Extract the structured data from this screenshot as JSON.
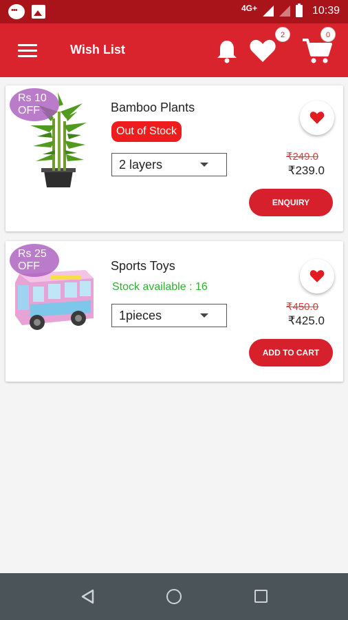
{
  "status_bar": {
    "network": "4G+",
    "time": "10:39"
  },
  "header": {
    "title": "Wish List",
    "wishlist_count": "2",
    "cart_count": "0"
  },
  "colors": {
    "primary": "#d9232d",
    "status_bar": "#a8141a",
    "stock_available": "#2fae33",
    "out_of_stock": "#ee1c1c",
    "badge": "#aa5abe"
  },
  "products": [
    {
      "name": "Bamboo Plants",
      "offer_line1": "Rs  10",
      "offer_line2": "OFF",
      "stock_status": "Out of Stock",
      "variant": "2 layers",
      "old_price": "₹249.0",
      "new_price": "₹239.0",
      "action": "ENQUIRY",
      "image": "bamboo-plant-image"
    },
    {
      "name": "Sports Toys",
      "offer_line1": "Rs  25",
      "offer_line2": "OFF",
      "stock_status": "Stock available : 16",
      "variant": "1pieces",
      "old_price": "₹450.0",
      "new_price": "₹425.0",
      "action": "ADD TO CART",
      "image": "toy-bus-image"
    }
  ],
  "icons": [
    "menu-icon",
    "bell-icon",
    "heart-icon",
    "cart-icon",
    "back-icon",
    "home-icon",
    "recents-icon"
  ]
}
